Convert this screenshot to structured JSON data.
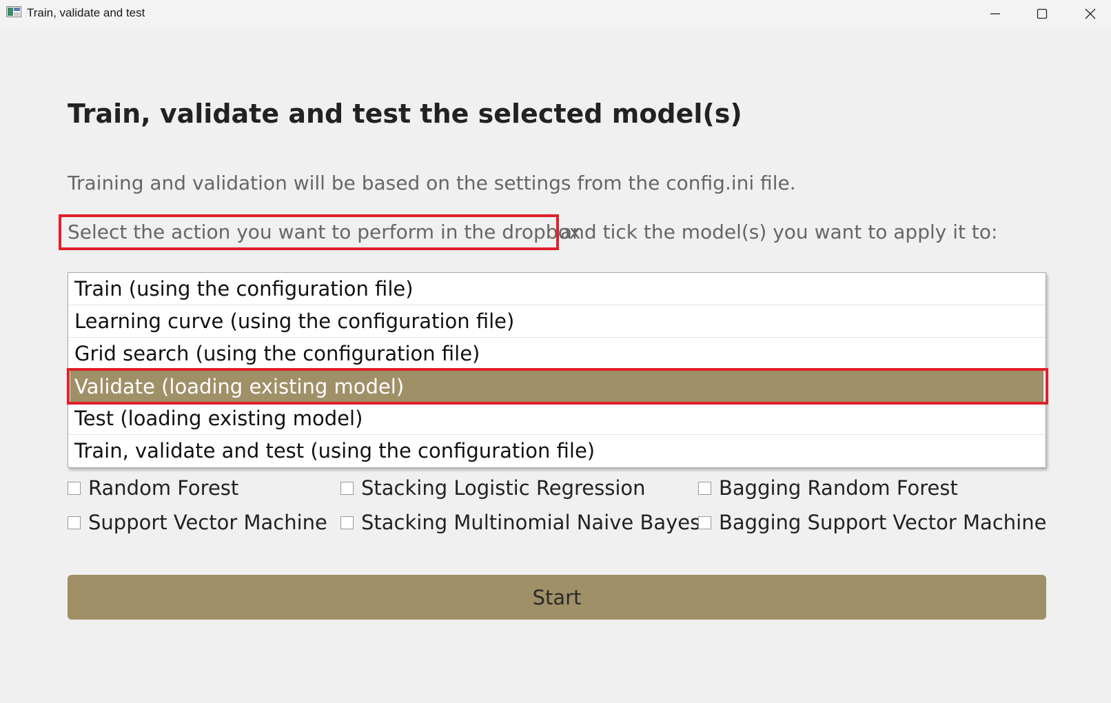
{
  "window": {
    "title": "Train, validate and test"
  },
  "heading": "Train, validate and test the selected model(s)",
  "description": "Training and validation will be based on the settings from the config.ini file.",
  "instruction": {
    "highlighted": "Select the action you want to perform in the dropbox",
    "rest": "and tick the model(s) you want to apply it to:"
  },
  "dropdown": {
    "options": [
      "Train (using the configuration file)",
      "Learning curve (using the configuration file)",
      "Grid search (using the configuration file)",
      "Validate (loading existing model)",
      "Test (loading existing model)",
      "Train, validate and test (using the configuration file)"
    ],
    "selected_index": 3
  },
  "models": [
    {
      "label": "Random Forest",
      "checked": false
    },
    {
      "label": "Stacking Logistic Regression",
      "checked": false
    },
    {
      "label": "Bagging Random Forest",
      "checked": false
    },
    {
      "label": "Support Vector Machine",
      "checked": false
    },
    {
      "label": "Stacking Multinomial Naive Bayes",
      "checked": false
    },
    {
      "label": "Bagging Support Vector Machine",
      "checked": false
    }
  ],
  "start_button": "Start",
  "colors": {
    "accent": "#a09068",
    "highlight_border": "#e0202a",
    "background": "#f0f0f0"
  },
  "icons": {
    "app": "app-window-icon",
    "minimize": "minimize-icon",
    "maximize": "maximize-icon",
    "close": "close-icon"
  }
}
